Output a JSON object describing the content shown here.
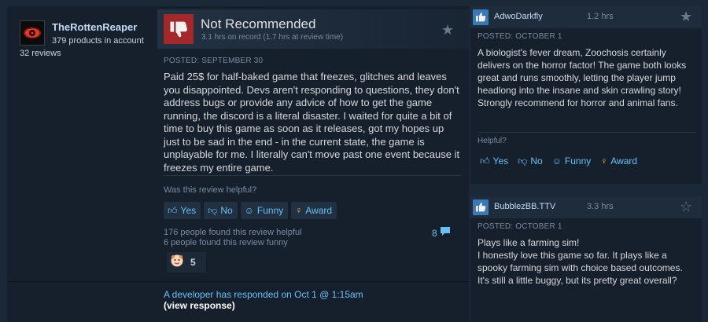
{
  "main_review": {
    "author": {
      "name": "TheRottenReaper",
      "products": "379 products in account",
      "reviews": "32 reviews",
      "avatar_icon": "eye-icon"
    },
    "verdict": "Not Recommended",
    "verdict_icon": "thumbs-down-icon",
    "hours": "3.1 hrs on record (1.7 hrs at review time)",
    "posted": "POSTED: SEPTEMBER 30",
    "text": "Paid 25$ for half-baked game that freezes, glitches and leaves you disappointed. Devs aren't responding to questions, they don't address bugs or provide any advice of how to get the game running, the discord is a literal disaster. I waited for quite a bit of time to buy this game as soon as it releases, got my hopes up just to be sad in the end - in the current state, the game is unplayable for me. I literally can't move past one event because it freezes my entire game.",
    "helpful_question": "Was this review helpful?",
    "buttons": {
      "yes": "Yes",
      "no": "No",
      "funny": "Funny",
      "award": "Award"
    },
    "helpful_count": "176 people found this review helpful",
    "funny_count": "6 people found this review funny",
    "comment_count": "8",
    "award_count": "5",
    "dev_response": "A developer has responded on Oct 1 @ 1:15am",
    "view_response": "(view response)"
  },
  "side_reviews": [
    {
      "name": "AdwoDarkfly",
      "hours": "1.2 hrs",
      "posted": "POSTED: OCTOBER 1",
      "text": "A biologist's fever dream, Zoochosis certainly delivers on the horror factor! The game both looks great and runs smoothly, letting the player jump headlong into the insane and skin crawling story! Strongly recommend for horror and animal fans.",
      "helpful": "Helpful?",
      "buttons": {
        "yes": "Yes",
        "no": "No",
        "funny": "Funny",
        "award": "Award"
      }
    },
    {
      "name": "BubblezBB.TTV",
      "hours": "3.3 hrs",
      "posted": "POSTED: OCTOBER 1",
      "text": "Plays like a farming sim!\nI honestly love this game so far. It plays like a spooky farming sim with choice based outcomes.\nIt's still a little buggy, but its pretty great overall?"
    }
  ],
  "colors": {
    "background": "#1b2838",
    "panel": "#16202d",
    "link": "#66c0f4",
    "not_recommended": "#a4282a",
    "recommended": "#3a78b6",
    "award": "#e4b844"
  }
}
